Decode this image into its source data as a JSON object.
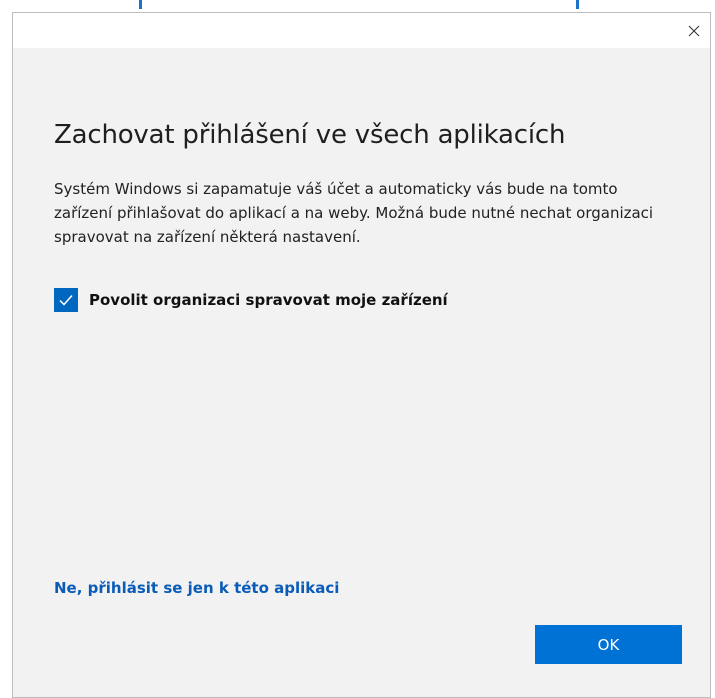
{
  "window": {
    "close_label": "×"
  },
  "dialog": {
    "title": "Zachovat přihlášení ve všech aplikacích",
    "description": "Systém Windows si zapamatuje váš účet a automaticky vás bude na tomto zařízení přihlašovat do aplikací a na weby. Možná bude nutné nechat organizaci spravovat na zařízení některá nastavení.",
    "checkbox": {
      "label": "Povolit organizaci spravovat moje zařízení",
      "checked": true
    },
    "link_label": "Ne, přihlásit se jen k této aplikaci",
    "ok_label": "OK"
  },
  "colors": {
    "accent": "#0067c0",
    "link": "#0a5cb8",
    "button": "#0072d6",
    "background": "#f2f2f2"
  }
}
